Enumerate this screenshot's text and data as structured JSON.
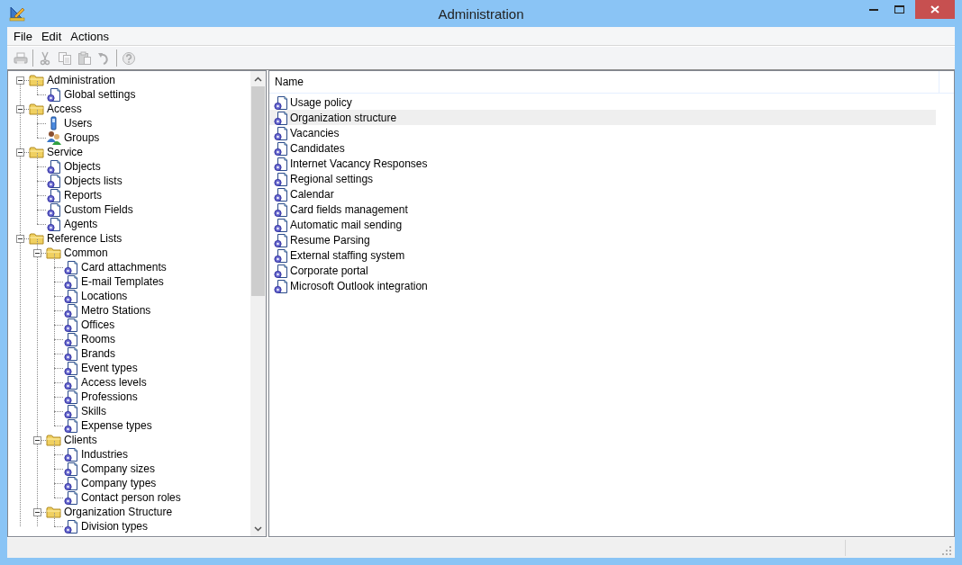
{
  "window": {
    "title": "Administration"
  },
  "menu": [
    "File",
    "Edit",
    "Actions"
  ],
  "toolbar": {
    "groups": [
      [
        {
          "kind": "print",
          "disabled": true
        }
      ],
      [
        {
          "kind": "cut",
          "disabled": true
        },
        {
          "kind": "copy",
          "disabled": true
        },
        {
          "kind": "paste",
          "disabled": true
        },
        {
          "kind": "undo",
          "disabled": true
        }
      ],
      [
        {
          "kind": "help",
          "disabled": true
        }
      ]
    ]
  },
  "tree": [
    {
      "label": "Administration",
      "kind": "folder",
      "expanded": true,
      "children": [
        {
          "label": "Global settings",
          "kind": "doc"
        }
      ]
    },
    {
      "label": "Access",
      "kind": "folder",
      "expanded": true,
      "children": [
        {
          "label": "Users",
          "kind": "user"
        },
        {
          "label": "Groups",
          "kind": "group"
        }
      ]
    },
    {
      "label": "Service",
      "kind": "folder",
      "expanded": true,
      "children": [
        {
          "label": "Objects",
          "kind": "doc"
        },
        {
          "label": "Objects lists",
          "kind": "doc"
        },
        {
          "label": "Reports",
          "kind": "doc"
        },
        {
          "label": "Custom Fields",
          "kind": "doc"
        },
        {
          "label": "Agents",
          "kind": "doc"
        }
      ]
    },
    {
      "label": "Reference Lists",
      "kind": "folder",
      "expanded": true,
      "children": [
        {
          "label": "Common",
          "kind": "folder",
          "expanded": true,
          "children": [
            {
              "label": "Card attachments",
              "kind": "doc"
            },
            {
              "label": "E-mail Templates",
              "kind": "doc"
            },
            {
              "label": "Locations",
              "kind": "doc"
            },
            {
              "label": "Metro Stations",
              "kind": "doc"
            },
            {
              "label": "Offices",
              "kind": "doc"
            },
            {
              "label": "Rooms",
              "kind": "doc"
            },
            {
              "label": "Brands",
              "kind": "doc"
            },
            {
              "label": "Event types",
              "kind": "doc"
            },
            {
              "label": "Access levels",
              "kind": "doc"
            },
            {
              "label": "Professions",
              "kind": "doc"
            },
            {
              "label": "Skills",
              "kind": "doc"
            },
            {
              "label": "Expense types",
              "kind": "doc"
            }
          ]
        },
        {
          "label": "Clients",
          "kind": "folder",
          "expanded": true,
          "children": [
            {
              "label": "Industries",
              "kind": "doc"
            },
            {
              "label": "Company sizes",
              "kind": "doc"
            },
            {
              "label": "Company types",
              "kind": "doc"
            },
            {
              "label": "Contact person roles",
              "kind": "doc"
            }
          ]
        },
        {
          "label": "Organization Structure",
          "kind": "folder",
          "expanded": true,
          "children": [
            {
              "label": "Division types",
              "kind": "doc"
            }
          ]
        }
      ]
    }
  ],
  "list": {
    "columns": [
      "Name"
    ],
    "rows": [
      {
        "label": "Usage policy",
        "selected": false
      },
      {
        "label": "Organization structure",
        "selected": true
      },
      {
        "label": "Vacancies",
        "selected": false
      },
      {
        "label": "Candidates",
        "selected": false
      },
      {
        "label": "Internet Vacancy Responses",
        "selected": false
      },
      {
        "label": "Regional settings",
        "selected": false
      },
      {
        "label": "Calendar",
        "selected": false
      },
      {
        "label": "Card fields management",
        "selected": false
      },
      {
        "label": "Automatic mail sending",
        "selected": false
      },
      {
        "label": "Resume Parsing",
        "selected": false
      },
      {
        "label": "External staffing system",
        "selected": false
      },
      {
        "label": "Corporate portal",
        "selected": false
      },
      {
        "label": "Microsoft Outlook integration",
        "selected": false
      }
    ]
  }
}
